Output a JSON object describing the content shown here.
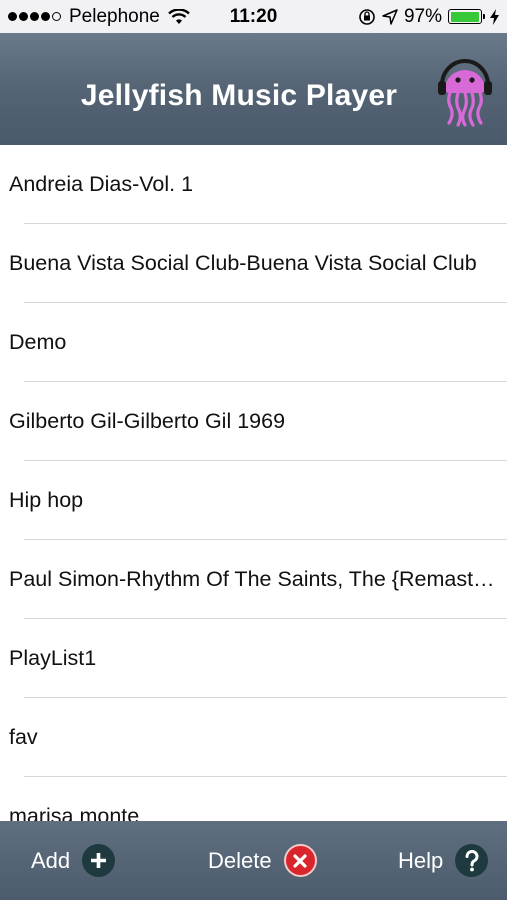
{
  "status_bar": {
    "carrier": "Pelephone",
    "time": "11:20",
    "battery": "97%",
    "battery_level": 0.97,
    "icons": [
      "signal-dots-icon",
      "wifi-icon",
      "rotation-lock-icon",
      "location-arrow-icon",
      "battery-icon",
      "charging-bolt-icon"
    ]
  },
  "header": {
    "title": "Jellyfish Music Player",
    "logo_icon": "jellyfish-headphones-icon"
  },
  "playlists": [
    {
      "label": "Andreia Dias-Vol. 1"
    },
    {
      "label": "Buena Vista Social Club-Buena Vista Social Club"
    },
    {
      "label": "Demo"
    },
    {
      "label": "Gilberto Gil-Gilberto Gil 1969"
    },
    {
      "label": "Hip hop"
    },
    {
      "label": "Paul Simon-Rhythm Of The Saints, The {Remastered}"
    },
    {
      "label": "PlayList1"
    },
    {
      "label": "fav"
    },
    {
      "label": "marisa monte"
    }
  ],
  "toolbar": {
    "add_label": "Add",
    "delete_label": "Delete",
    "help_label": "Help",
    "add_icon": "plus-circle-icon",
    "delete_icon": "close-circle-icon",
    "help_icon": "question-circle-icon"
  },
  "colors": {
    "header": "#546474",
    "toolbar": "#4c5c6c",
    "delete": "#d9262c",
    "jellyfish": "#d86ad8"
  }
}
